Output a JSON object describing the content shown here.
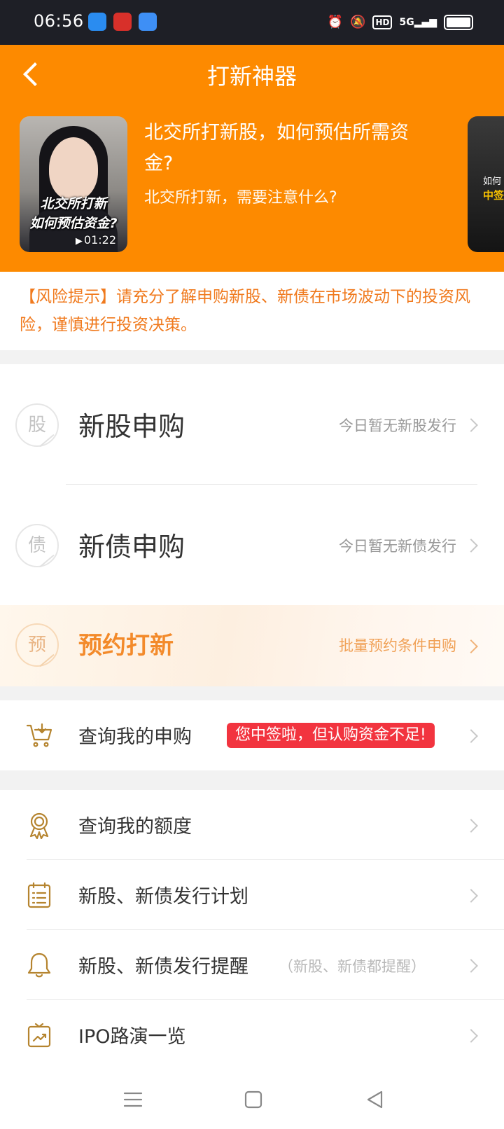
{
  "status_bar": {
    "time": "06:56",
    "network": "5G",
    "hd_label": "HD"
  },
  "header": {
    "title": "打新神器",
    "video": {
      "title": "北交所打新股，如何预估所需资金?",
      "subtitle": "北交所打新，需要注意什么?",
      "caption_line1": "北交所打新",
      "caption_line2": "如何预估资金?",
      "duration": "01:22"
    },
    "next_video_caption1": "如何",
    "next_video_caption2": "中签"
  },
  "risk_notice": "【风险提示】请充分了解申购新股、新债在市场波动下的投资风险，谨慎进行投资决策。",
  "main_rows": [
    {
      "icon_char": "股",
      "label": "新股申购",
      "status": "今日暂无新股发行"
    },
    {
      "icon_char": "债",
      "label": "新债申购",
      "status": "今日暂无新债发行"
    },
    {
      "icon_char": "预",
      "label": "预约打新",
      "status": "批量预约条件申购"
    }
  ],
  "my_subscription": {
    "label": "查询我的申购",
    "alert": "您中签啦，但认购资金不足!"
  },
  "list": [
    {
      "label": "查询我的额度",
      "hint": ""
    },
    {
      "label": "新股、新债发行计划",
      "hint": ""
    },
    {
      "label": "新股、新债发行提醒",
      "hint": "（新股、新债都提醒）"
    },
    {
      "label": "IPO路演一览",
      "hint": ""
    }
  ],
  "colors": {
    "brand_orange": "#fd8a00",
    "risk_text": "#f07a1e",
    "alert_red": "#f2343f",
    "icon_gold": "#b5842f"
  }
}
